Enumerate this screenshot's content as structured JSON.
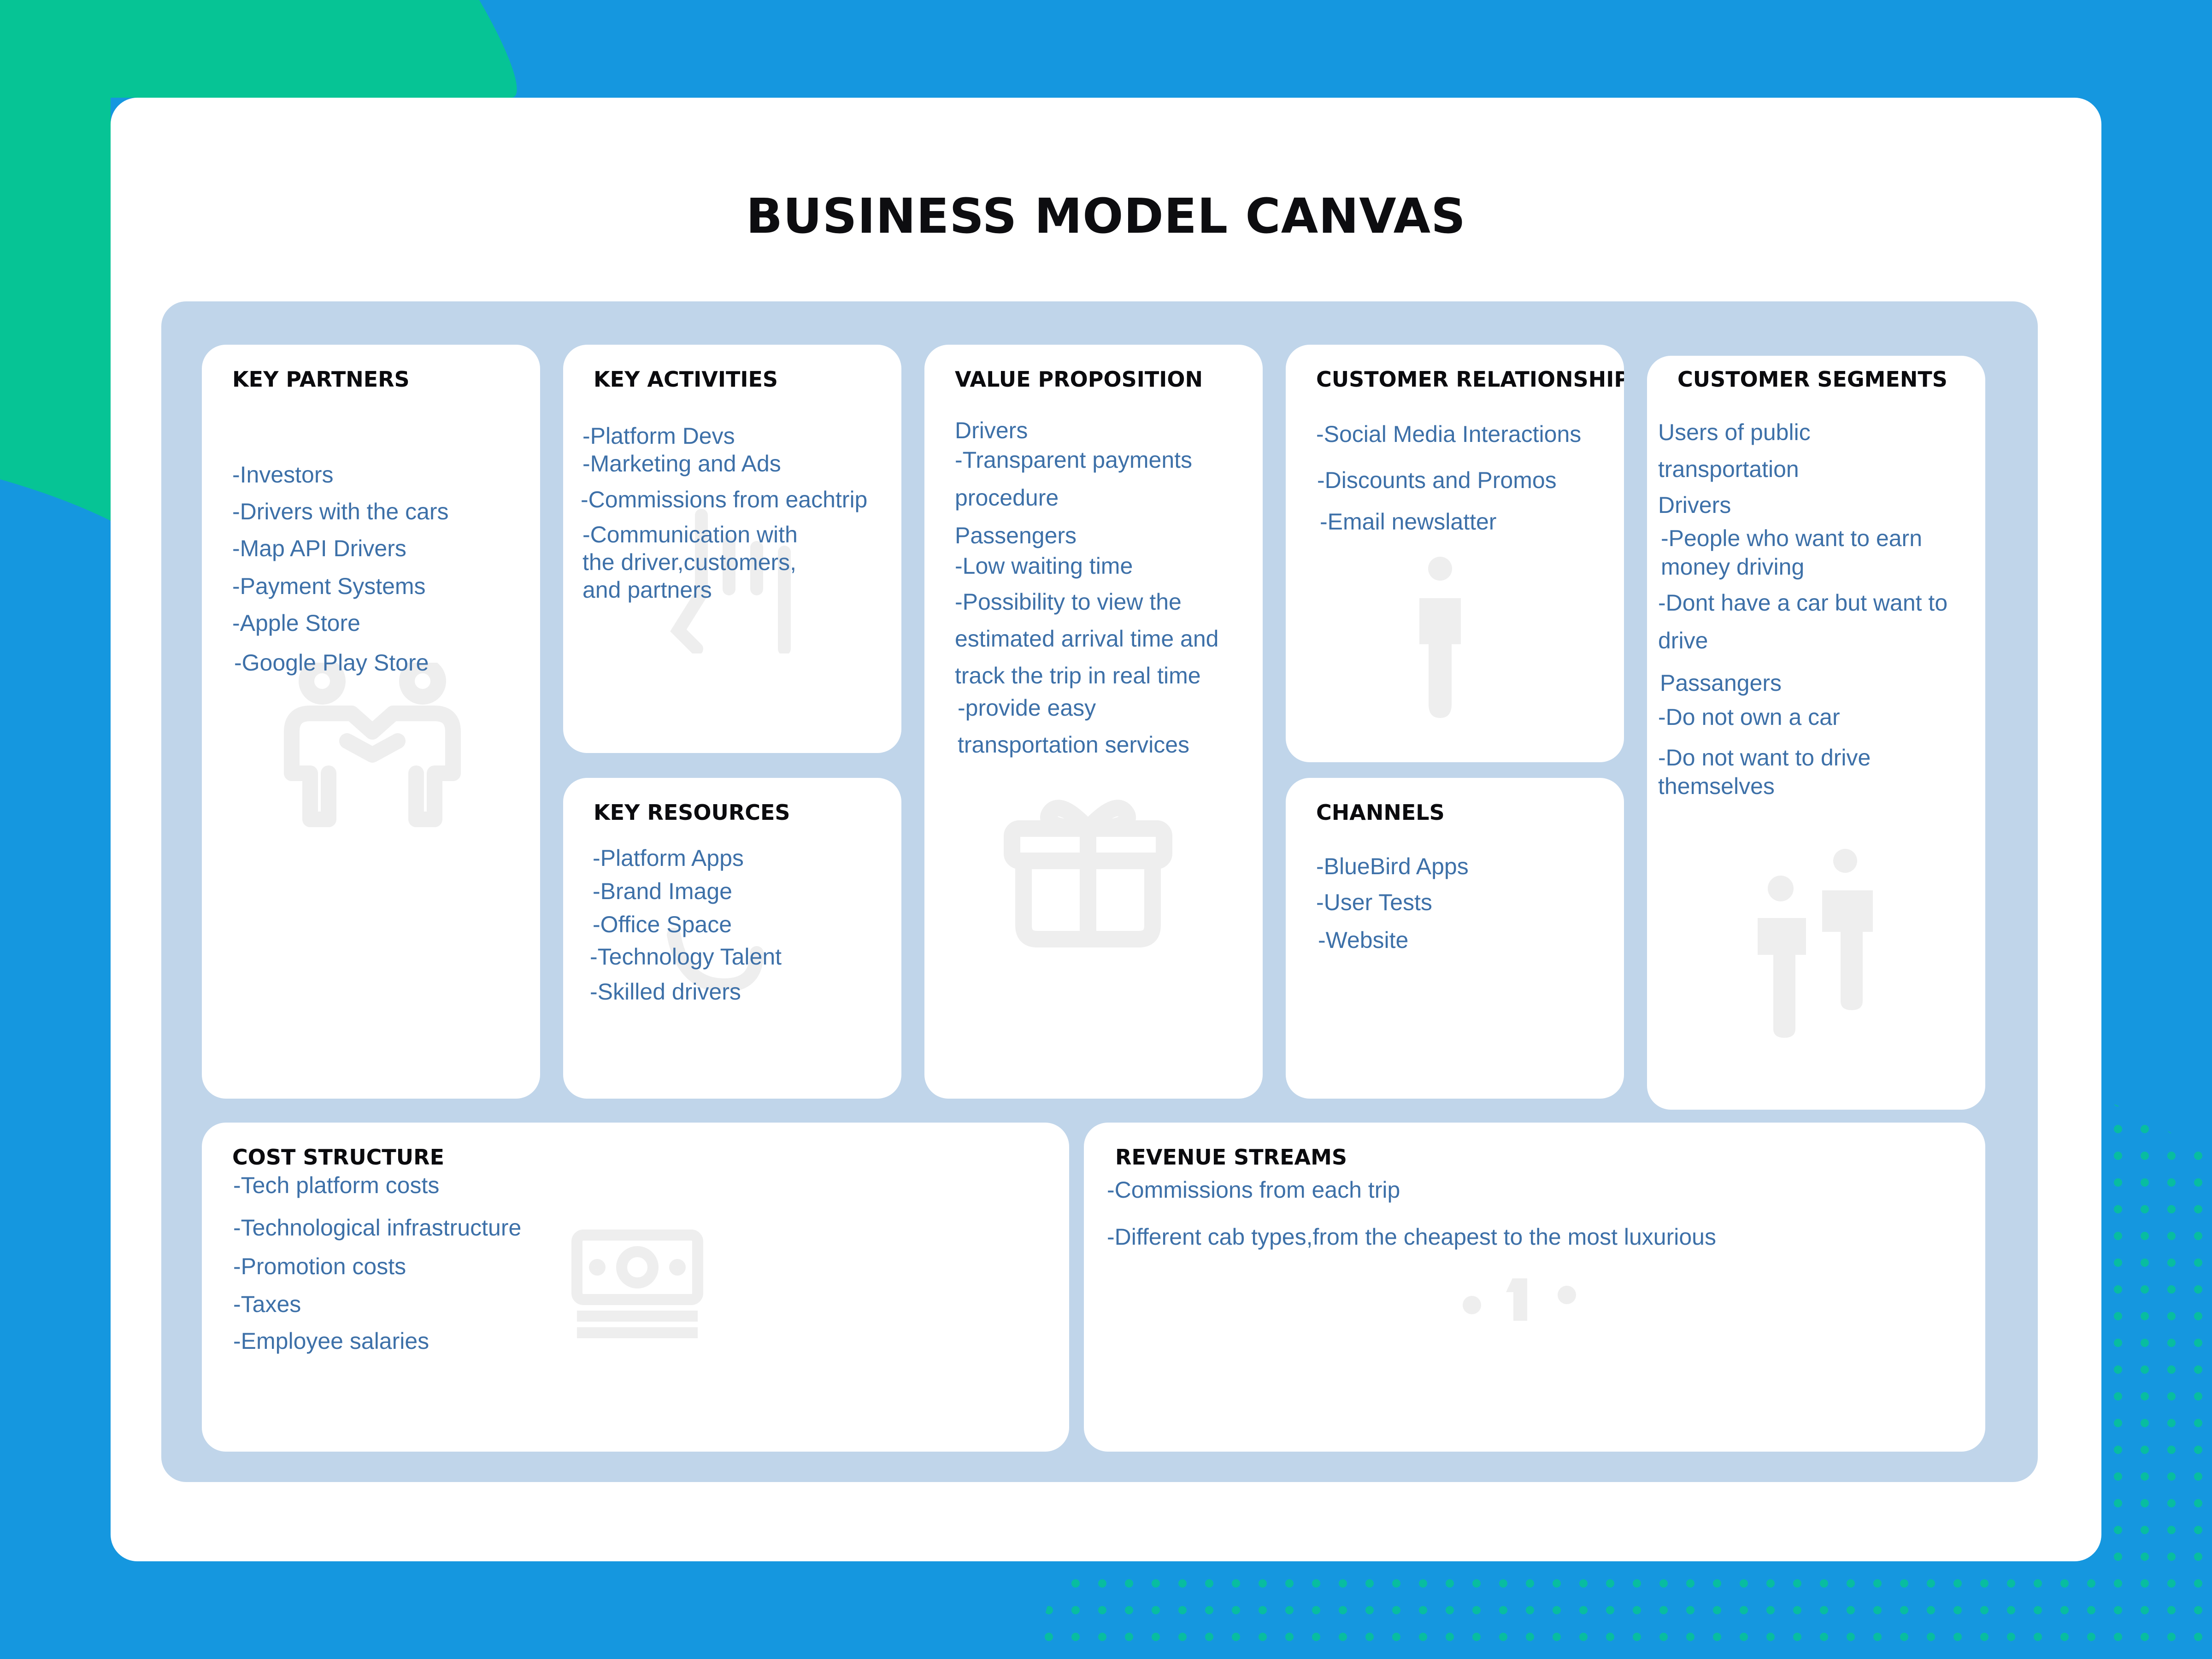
{
  "title": "BUSINESS MODEL CANVAS",
  "colors": {
    "background": "#1597df",
    "accent_green": "#06c495",
    "panel": "#c0d5ea",
    "card": "#ffffff",
    "heading_text": "#0b0b0e",
    "body_text": "#3d70a8",
    "ghost_icon": "#eeeeee"
  },
  "sections": {
    "key_partners": {
      "title": "KEY PARTNERS",
      "icon": "partners-icon",
      "items": [
        "-Investors",
        "-Drivers with the cars",
        "-Map API Drivers",
        "-Payment Systems",
        "-Apple Store",
        "-Google Play Store"
      ]
    },
    "key_activities": {
      "title": "KEY ACTIVITIES",
      "icon": "hand-icon",
      "items": [
        "-Platform Devs",
        "-Marketing and Ads",
        "-Commissions from eachtrip",
        "-Communication with",
        "the driver,customers,",
        "and partners"
      ]
    },
    "key_resources": {
      "title": "KEY RESOURCES",
      "icon": "leaf-icon",
      "items": [
        "-Platform Apps",
        "-Brand Image",
        "-Office Space",
        "-Technology Talent",
        "-Skilled drivers"
      ]
    },
    "value_proposition": {
      "title": "VALUE PROPOSITION",
      "icon": "gift-icon",
      "items": [
        "Drivers",
        "-Transparent payments",
        "procedure",
        "Passengers",
        "-Low waiting time",
        "-Possibility to view  the",
        "estimated arrival time and",
        "track the trip in real time",
        "-provide easy",
        "transportation services"
      ]
    },
    "customer_relationships": {
      "title": "CUSTOMER RELATIONSHIPS",
      "icon": "person-icon",
      "items": [
        "-Social Media Interactions",
        "-Discounts and Promos",
        "-Email newslatter"
      ]
    },
    "channels": {
      "title": "CHANNELS",
      "items": [
        "-BlueBird Apps",
        "-User Tests",
        "-Website"
      ]
    },
    "customer_segments": {
      "title": "CUSTOMER SEGMENTS",
      "icon": "people-icon",
      "items": [
        "Users of public",
        "transportation",
        "Drivers",
        "-People who want  to earn",
        "money driving",
        "-Dont have a car but  want to",
        "drive",
        "Passangers",
        "-Do not own  a car",
        "-Do not want to drive",
        "themselves"
      ]
    },
    "cost_structure": {
      "title": "COST STRUCTURE",
      "icon": "cash-icon",
      "items": [
        "-Tech platform costs",
        "-Technological infrastructure",
        "-Promotion costs",
        "-Taxes",
        "-Employee salaries"
      ]
    },
    "revenue_streams": {
      "title": "REVENUE STREAMS",
      "icon": "dollar-icon",
      "items": [
        "-Commissions  from each  trip",
        "-Different cab types,from the cheapest to the most luxurious"
      ]
    }
  }
}
